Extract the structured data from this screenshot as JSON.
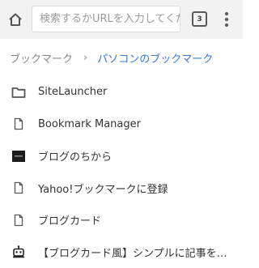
{
  "toolbar": {
    "search_placeholder": "検索するかURLを入力してください",
    "tab_count": "3"
  },
  "breadcrumb": {
    "root": "ブックマーク",
    "separator": "›",
    "current": "パソコンのブックマーク"
  },
  "bookmarks": [
    {
      "label": "SiteLauncher",
      "icon": "folder-icon"
    },
    {
      "label": "Bookmark Manager",
      "icon": "page-icon"
    },
    {
      "label": "ブログのちから",
      "icon": "site-favicon"
    },
    {
      "label": "Yahoo!ブックマークに登録",
      "icon": "page-icon"
    },
    {
      "label": "ブログカード",
      "icon": "page-icon"
    },
    {
      "label": "【ブログカード風】シンプルに記事をシェアする",
      "icon": "robot-favicon"
    }
  ],
  "colors": {
    "toolbar_bg": "#f2f2f2",
    "breadcrumb_active": "#3a7ad6",
    "text": "#333333"
  }
}
